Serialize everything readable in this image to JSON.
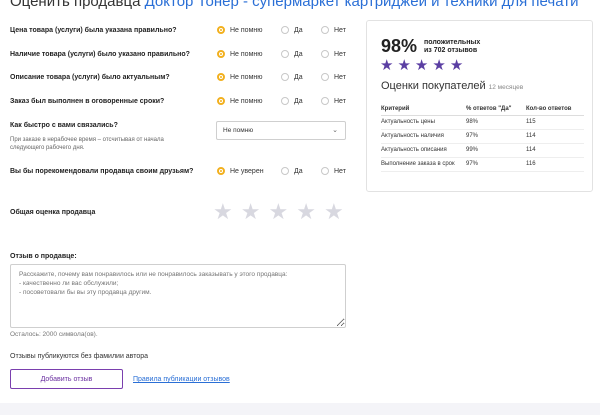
{
  "page": {
    "title_prefix": "Оценить продавца ",
    "title_shop": "Доктор Тонер - супермаркет картриджей и техники для печати"
  },
  "questions": [
    {
      "label": "Цена товара (услуги) была указана правильно?",
      "options": [
        "Не помню",
        "Да",
        "Нет"
      ],
      "selected": 0
    },
    {
      "label": "Наличие товара (услуги) было указано правильно?",
      "options": [
        "Не помню",
        "Да",
        "Нет"
      ],
      "selected": 0
    },
    {
      "label": "Описание товара (услуги) было актуальным?",
      "options": [
        "Не помню",
        "Да",
        "Нет"
      ],
      "selected": 0
    },
    {
      "label": "Заказ был выполнен в оговоренные сроки?",
      "options": [
        "Не помню",
        "Да",
        "Нет"
      ],
      "selected": 0
    }
  ],
  "contact": {
    "label": "Как быстро с вами связались?",
    "hint": "При заказе в нерабочее время – отсчитывая от начала следующего рабочего дня.",
    "select_value": "Не помню"
  },
  "recommend": {
    "label": "Вы бы порекомендовали продавца своим друзьям?",
    "options": [
      "Не уверен",
      "Да",
      "Нет"
    ],
    "selected": 0
  },
  "overall": {
    "label": "Общая оценка продавца",
    "stars_selected": 0
  },
  "review": {
    "label": "Отзыв о продавце:",
    "placeholder": "Расскажите, почему вам понравилось или не понравилось заказывать у этого продавца:\n- качественно ли вас обслужили;\n- посоветовали бы вы эту продавца другим.",
    "remaining": "Осталось: 2000 символа(ов)."
  },
  "anon_note": "Отзывы публикуются без фамилии автора",
  "submit_label": "Добавить отзыв",
  "rules_link": "Правила публикации отзывов",
  "summary": {
    "percent": "98%",
    "positive_line1": "положительных",
    "positive_line2": "из 702 отзывов",
    "star_rating": 5,
    "title": "Оценки покупателей",
    "period": "12 месяцев",
    "columns": [
      "Критерий",
      "% ответов \"Да\"",
      "Кол-во ответов"
    ],
    "rows": [
      [
        "Актуальность цены",
        "98%",
        "115"
      ],
      [
        "Актуальность наличия",
        "97%",
        "114"
      ],
      [
        "Актуальность описания",
        "99%",
        "114"
      ],
      [
        "Выполнение заказа в срок",
        "97%",
        "116"
      ]
    ]
  },
  "colors": {
    "accent": "#f2b01e",
    "brand": "#5b3fa3",
    "link": "#2a6fd6"
  }
}
